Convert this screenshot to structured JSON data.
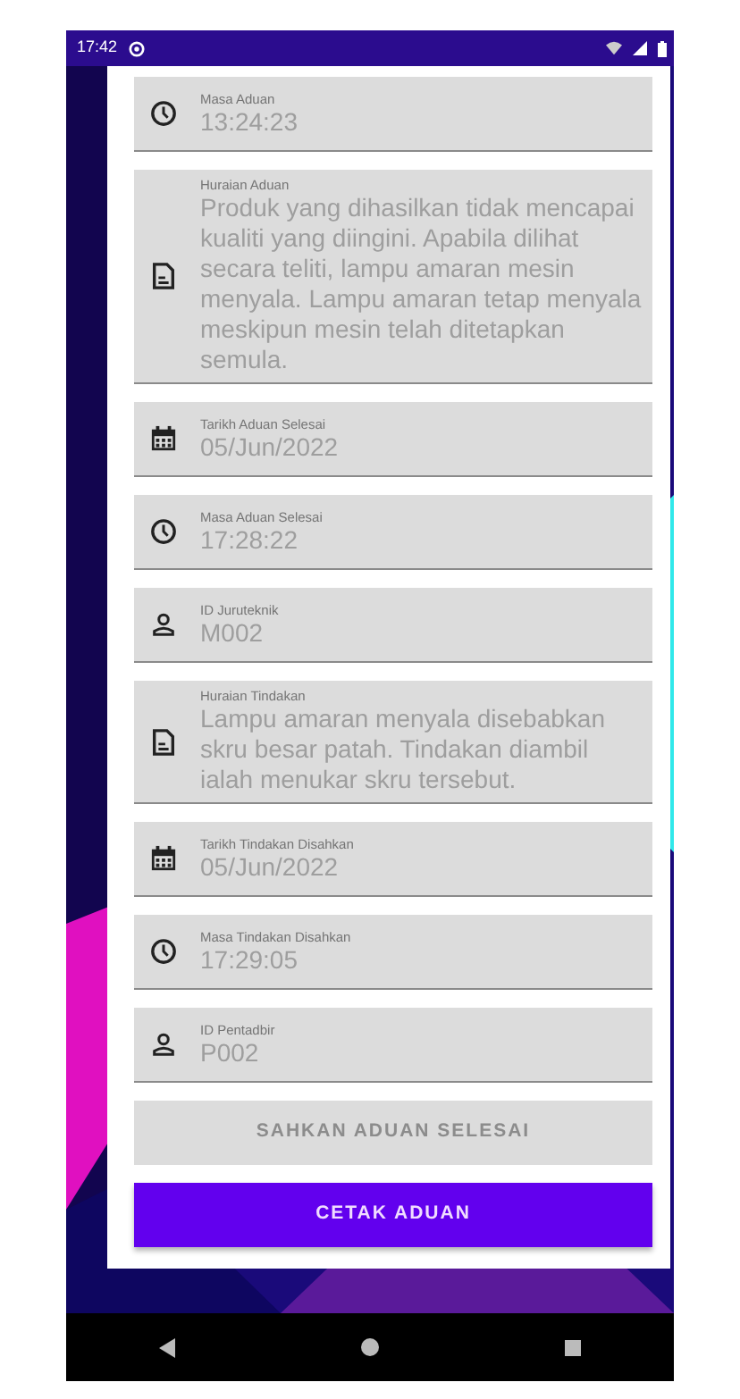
{
  "status_bar": {
    "time": "17:42"
  },
  "fields": [
    {
      "kind": "time",
      "label": "Masa Aduan",
      "value": "13:24:23"
    },
    {
      "kind": "text",
      "label": "Huraian Aduan",
      "value": "Produk yang dihasilkan tidak mencapai kualiti yang diingini. Apabila dilihat secara teliti, lampu amaran mesin menyala. Lampu amaran tetap menyala meskipun mesin telah ditetapkan semula."
    },
    {
      "kind": "date",
      "label": "Tarikh Aduan Selesai",
      "value": "05/Jun/2022"
    },
    {
      "kind": "time",
      "label": "Masa Aduan Selesai",
      "value": "17:28:22"
    },
    {
      "kind": "person",
      "label": "ID Juruteknik",
      "value": "M002"
    },
    {
      "kind": "text",
      "label": "Huraian Tindakan",
      "value": "Lampu amaran menyala disebabkan skru besar patah. Tindakan diambil ialah menukar skru tersebut."
    },
    {
      "kind": "date",
      "label": "Tarikh Tindakan Disahkan",
      "value": "05/Jun/2022"
    },
    {
      "kind": "time",
      "label": "Masa Tindakan Disahkan",
      "value": "17:29:05"
    },
    {
      "kind": "person",
      "label": "ID Pentadbir",
      "value": "P002"
    }
  ],
  "buttons": [
    {
      "label": "SAHKAN ADUAN SELESAI",
      "disabled": true
    },
    {
      "label": "CETAK ADUAN",
      "disabled": false
    }
  ]
}
